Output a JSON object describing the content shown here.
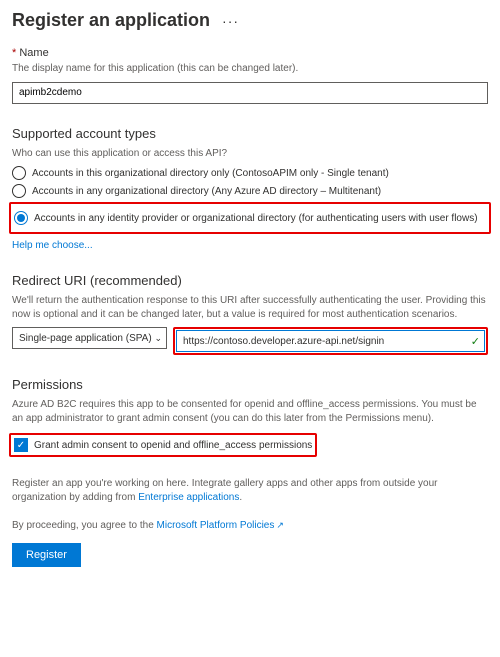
{
  "header": {
    "title": "Register an application"
  },
  "name": {
    "label": "Name",
    "desc": "The display name for this application (this can be changed later).",
    "value": "apimb2cdemo"
  },
  "account_types": {
    "title": "Supported account types",
    "desc": "Who can use this application or access this API?",
    "options": [
      "Accounts in this organizational directory only (ContosoAPIM only - Single tenant)",
      "Accounts in any organizational directory (Any Azure AD directory – Multitenant)",
      "Accounts in any identity provider or organizational directory (for authenticating users with user flows)"
    ],
    "help_link": "Help me choose..."
  },
  "redirect": {
    "title": "Redirect URI (recommended)",
    "desc": "We'll return the authentication response to this URI after successfully authenticating the user. Providing this now is optional and it can be changed later, but a value is required for most authentication scenarios.",
    "platform": "Single-page application (SPA)",
    "url": "https://contoso.developer.azure-api.net/signin"
  },
  "permissions": {
    "title": "Permissions",
    "desc": "Azure AD B2C requires this app to be consented for openid and offline_access permissions. You must be an app administrator to grant admin consent (you can do this later from the Permissions menu).",
    "checkbox_label": "Grant admin consent to openid and offline_access permissions"
  },
  "footer": {
    "register_desc_1": "Register an app you're working on here. Integrate gallery apps and other apps from outside your organization by adding from ",
    "register_desc_link": "Enterprise applications",
    "proceed_text": "By proceeding, you agree to the ",
    "proceed_link": "Microsoft Platform Policies",
    "button": "Register"
  }
}
